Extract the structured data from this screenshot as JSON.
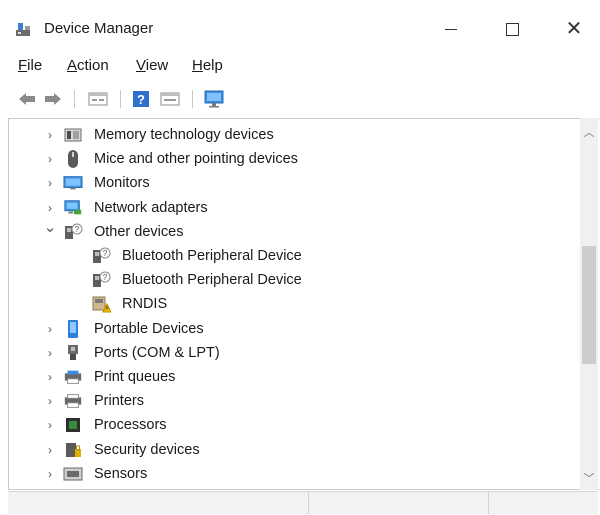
{
  "window": {
    "title": "Device Manager",
    "app_icon": "device-manager-icon",
    "controls": [
      "minimize",
      "maximize",
      "close"
    ]
  },
  "menu": {
    "file": {
      "pre": "",
      "accel": "F",
      "post": "ile"
    },
    "action": {
      "pre": "",
      "accel": "A",
      "post": "ction"
    },
    "view": {
      "pre": "",
      "accel": "V",
      "post": "iew"
    },
    "help": {
      "pre": "",
      "accel": "H",
      "post": "elp"
    }
  },
  "toolbar": {
    "buttons": [
      "back-arrow-icon",
      "forward-arrow-icon",
      "properties-icon",
      "help-icon",
      "view-icon",
      "scan-monitor-icon"
    ]
  },
  "tree": {
    "items": [
      {
        "label": "Memory technology devices",
        "icon": "memory-chip-icon",
        "state": "collapsed",
        "level": 0
      },
      {
        "label": "Mice and other pointing devices",
        "icon": "mouse-icon",
        "state": "collapsed",
        "level": 0
      },
      {
        "label": "Monitors",
        "icon": "monitor-icon",
        "state": "collapsed",
        "level": 0
      },
      {
        "label": "Network adapters",
        "icon": "network-adapter-icon",
        "state": "collapsed",
        "level": 0
      },
      {
        "label": "Other devices",
        "icon": "unknown-device-icon",
        "state": "expanded",
        "level": 0
      },
      {
        "label": "Bluetooth Peripheral Device",
        "icon": "unknown-device-icon",
        "state": "leaf",
        "level": 1
      },
      {
        "label": "Bluetooth Peripheral Device",
        "icon": "unknown-device-icon",
        "state": "leaf",
        "level": 1
      },
      {
        "label": "RNDIS",
        "icon": "warning-device-icon",
        "state": "leaf",
        "level": 1
      },
      {
        "label": "Portable Devices",
        "icon": "portable-device-icon",
        "state": "collapsed",
        "level": 0
      },
      {
        "label": "Ports (COM & LPT)",
        "icon": "port-icon",
        "state": "collapsed",
        "level": 0
      },
      {
        "label": "Print queues",
        "icon": "print-queue-icon",
        "state": "collapsed",
        "level": 0
      },
      {
        "label": "Printers",
        "icon": "printer-icon",
        "state": "collapsed",
        "level": 0
      },
      {
        "label": "Processors",
        "icon": "processor-icon",
        "state": "collapsed",
        "level": 0
      },
      {
        "label": "Security devices",
        "icon": "security-device-icon",
        "state": "collapsed",
        "level": 0
      },
      {
        "label": "Sensors",
        "icon": "sensor-icon",
        "state": "collapsed",
        "level": 0
      }
    ]
  },
  "colors": {
    "accent_blue": "#2f7fd6",
    "warning_yellow": "#f2c200"
  }
}
